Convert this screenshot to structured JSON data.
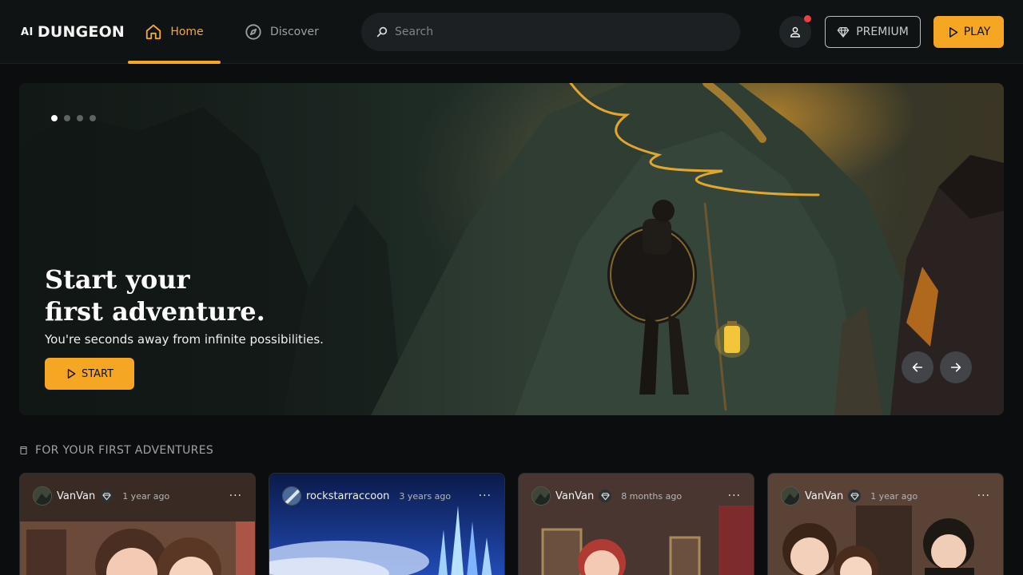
{
  "logo": {
    "prefix": "AI",
    "name": "DUNGEON"
  },
  "nav": {
    "home": "Home",
    "discover": "Discover"
  },
  "search": {
    "placeholder": "Search"
  },
  "header": {
    "premium_label": "PREMIUM",
    "play_label": "PLAY"
  },
  "hero": {
    "title_line1": "Start your",
    "title_line2": "first adventure.",
    "subtitle": "You're seconds away from infinite possibilities.",
    "start_label": "START",
    "slide_count": 4,
    "active_slide": 1
  },
  "section": {
    "title": "FOR YOUR FIRST ADVENTURES"
  },
  "cards": [
    {
      "user": "VanVan",
      "premium": true,
      "time": "1 year ago"
    },
    {
      "user": "rockstarraccoon",
      "premium": false,
      "time": "3 years ago"
    },
    {
      "user": "VanVan",
      "premium": true,
      "time": "8 months ago"
    },
    {
      "user": "VanVan",
      "premium": true,
      "time": "1 year ago"
    }
  ],
  "colors": {
    "accent": "#f5a623",
    "background": "#0c0d0e",
    "topbar": "#101314",
    "notification": "#ef3e42"
  },
  "icons": {
    "home": "home-icon",
    "discover": "compass-icon",
    "search": "search-icon",
    "profile": "user-icon",
    "premium": "diamond-icon",
    "play": "play-icon",
    "prev": "arrow-left-icon",
    "next": "arrow-right-icon",
    "section": "scroll-icon",
    "more": "more-icon"
  }
}
